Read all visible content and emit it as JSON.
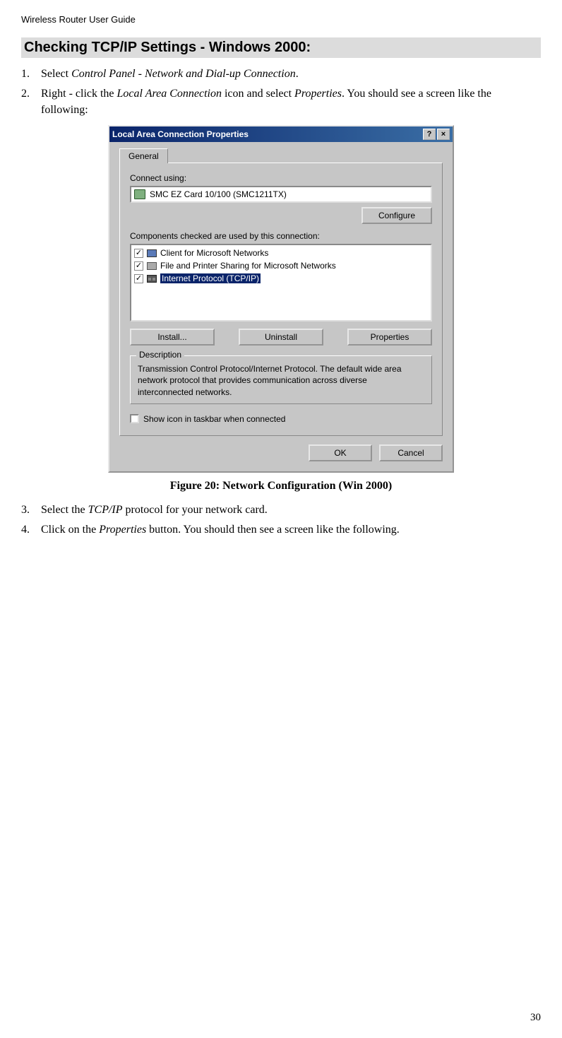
{
  "header": "Wireless Router User Guide",
  "sectionTitle": "Checking TCP/IP Settings - Windows 2000:",
  "steps": {
    "s1": {
      "num": "1.",
      "pre": "Select ",
      "italic": "Control Panel - Network and Dial-up Connection",
      "post": "."
    },
    "s2": {
      "num": "2.",
      "pre": "Right - click the ",
      "italic1": "Local Area Connection",
      "mid": " icon and select ",
      "italic2": "Properties",
      "post": ". You should see a screen like the following:"
    },
    "s3": {
      "num": "3.",
      "pre": "Select the ",
      "italic": "TCP/IP",
      "post": " protocol for your network card."
    },
    "s4": {
      "num": "4.",
      "pre": "Click on the ",
      "italic": "Properties",
      "post": " button. You should then see a screen like the following."
    }
  },
  "dialog": {
    "title": "Local Area Connection Properties",
    "helpBtn": "?",
    "closeBtn": "×",
    "tab": "General",
    "connectLabel": "Connect using:",
    "nic": "SMC EZ Card 10/100 (SMC1211TX)",
    "configureBtn": "Configure",
    "componentsLabel": "Components checked are used by this connection:",
    "items": {
      "i1": "Client for Microsoft Networks",
      "i2": "File and Printer Sharing for Microsoft Networks",
      "i3": "Internet Protocol (TCP/IP)"
    },
    "installBtn": "Install...",
    "uninstallBtn": "Uninstall",
    "propertiesBtn": "Properties",
    "descLegend": "Description",
    "descText": "Transmission Control Protocol/Internet Protocol. The default wide area network protocol that provides communication across diverse interconnected networks.",
    "showIcon": "Show icon in taskbar when connected",
    "okBtn": "OK",
    "cancelBtn": "Cancel"
  },
  "figureCaption": "Figure 20: Network Configuration (Win 2000)",
  "pageNum": "30"
}
